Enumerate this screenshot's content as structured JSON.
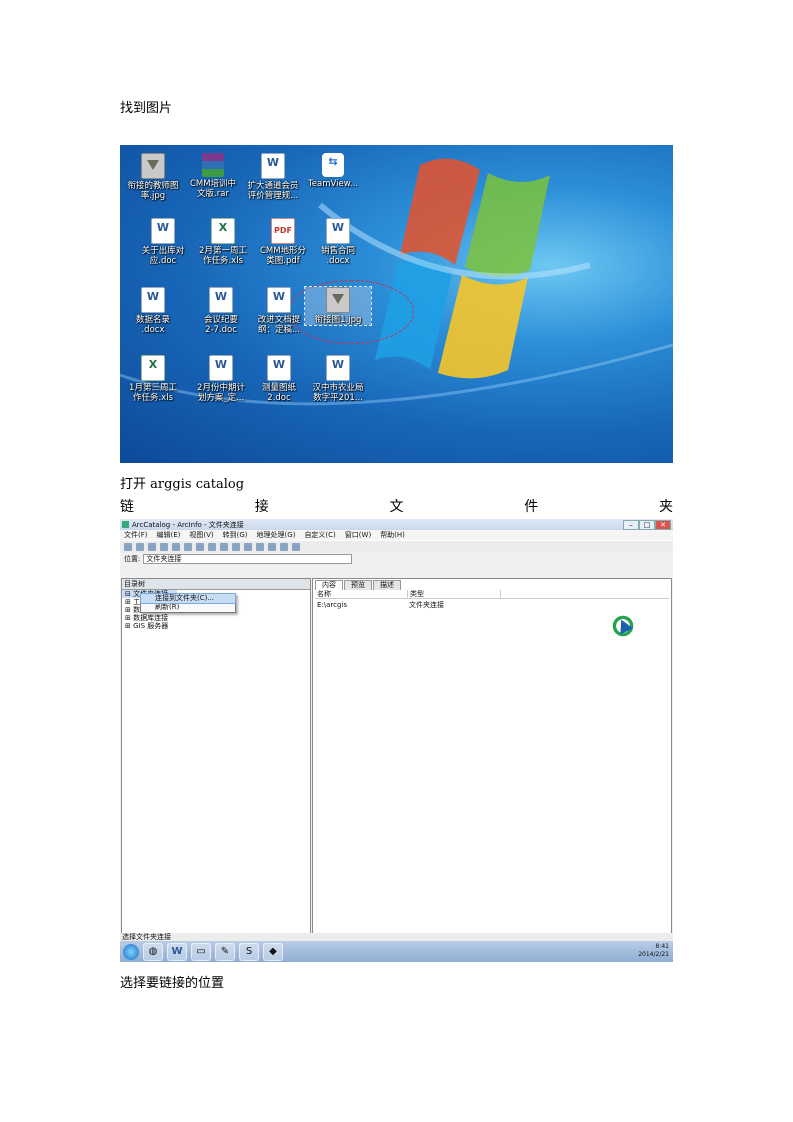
{
  "doc": {
    "p1": "找到图片",
    "p2": "打开 arggis catalog",
    "p3_chars": [
      "链",
      "接",
      "文",
      "件",
      "夹"
    ],
    "p4": "选择要链接的位置"
  },
  "desktop": {
    "icons": [
      {
        "label": "衔接的教师图\n率.jpg",
        "kind": "jpg",
        "glyph": ""
      },
      {
        "label": "CMM培训中\n文版.rar",
        "kind": "rar",
        "glyph": ""
      },
      {
        "label": "扩大通道会员\n评价管理规...",
        "kind": "word",
        "glyph": "W"
      },
      {
        "label": "TeamView...",
        "kind": "tv",
        "glyph": "⇆"
      },
      {
        "label": "关于出库对\n应.doc",
        "kind": "word",
        "glyph": "W"
      },
      {
        "label": "2月第一周工\n作任务.xls",
        "kind": "excel",
        "glyph": "X"
      },
      {
        "label": "CMM地形分\n类图.pdf",
        "kind": "pdf",
        "glyph": "PDF"
      },
      {
        "label": "销售合同\n.docx",
        "kind": "word",
        "glyph": "W"
      },
      {
        "label": "数据名录\n.docx",
        "kind": "word",
        "glyph": "W"
      },
      {
        "label": "会议纪要\n2-7.doc",
        "kind": "word",
        "glyph": "W"
      },
      {
        "label": "改进文档提\n纲：定稿...",
        "kind": "word",
        "glyph": "W"
      },
      {
        "label": "衔接图1.jpg",
        "kind": "jpg",
        "glyph": ""
      },
      {
        "label": "1月第三周工\n作任务.xls",
        "kind": "excel",
        "glyph": "X"
      },
      {
        "label": "2月份中期计\n划方案_定...",
        "kind": "word",
        "glyph": "W"
      },
      {
        "label": "测量图纸\n2.doc",
        "kind": "word",
        "glyph": "W"
      },
      {
        "label": "汉中市农业局\n数字平201...",
        "kind": "word",
        "glyph": "W"
      }
    ]
  },
  "arc": {
    "title": "ArcCatalog - ArcInfo - 文件夹连接",
    "window_buttons": [
      "–",
      "□",
      "✕"
    ],
    "menu": [
      "文件(F)",
      "编辑(E)",
      "视图(V)",
      "转到(G)",
      "地理处理(G)",
      "自定义(C)",
      "窗口(W)",
      "帮助(H)"
    ],
    "address_label": "位置:",
    "address_value": "文件夹连接",
    "tree_header": "目录树",
    "tree_items": [
      "⊟ 文件夹连接",
      "⊞ 工具箱",
      "⊞ 数据库服务器",
      "⊞ 数据库连接",
      "⊞ GIS 服务器"
    ],
    "context_menu": [
      "连接到文件夹(C)...",
      "刷新(R)"
    ],
    "tabs": [
      "内容",
      "预览",
      "描述"
    ],
    "columns": [
      "名称",
      "类型"
    ],
    "rows": [
      {
        "name": "E:\\arcgis",
        "type": "文件夹连接"
      }
    ],
    "status": "选择文件夹连接",
    "clock": "8:41",
    "date": "2014/2/21"
  }
}
